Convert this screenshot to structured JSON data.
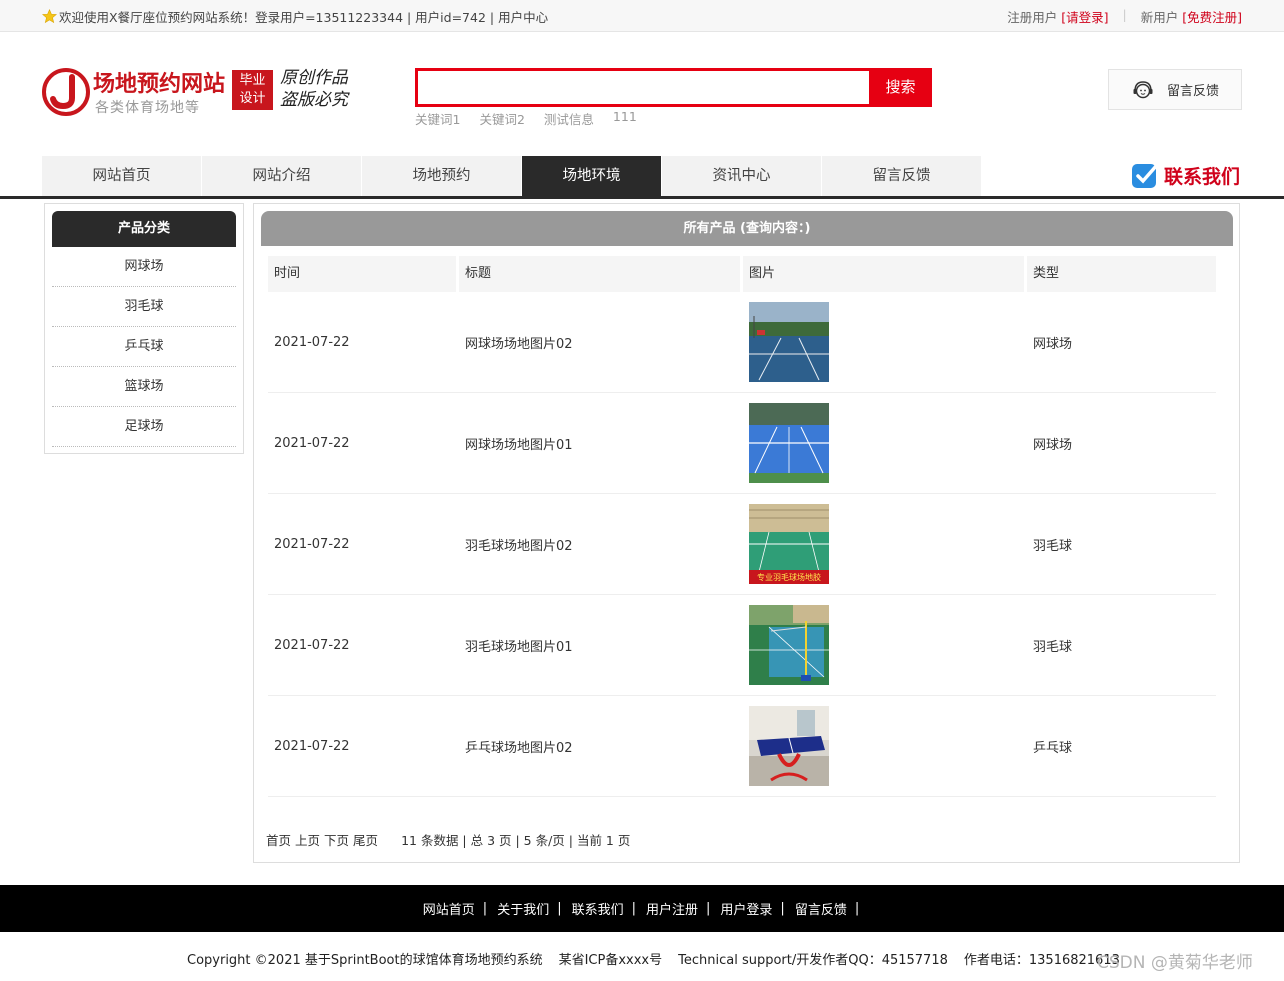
{
  "topbar": {
    "welcome": "欢迎使用X餐厅座位预约网站系统！登录用户=13511223344 | 用户id=742 | 用户中心",
    "register_user_label": "注册用户",
    "login_link": "[请登录]",
    "new_user_label": "新用户",
    "signup_link": "[免费注册]"
  },
  "header": {
    "logo_title": "场地预约网站",
    "logo_subtitle": "各类体育场地等",
    "stamp_line1": "毕业",
    "stamp_line2": "设计",
    "slogan_line1": "原创作品",
    "slogan_line2": "盗版必究",
    "search_value": "",
    "search_button": "搜索",
    "hotwords": [
      "关键词1",
      "关键词2",
      "测试信息",
      "111"
    ],
    "feedback_label": "留言反馈"
  },
  "nav": {
    "items": [
      "网站首页",
      "网站介绍",
      "场地预约",
      "场地环境",
      "资讯中心",
      "留言反馈"
    ],
    "active_index": 3,
    "contact_label": "联系我们"
  },
  "sidebar": {
    "title": "产品分类",
    "items": [
      "网球场",
      "羽毛球",
      "乒乓球",
      "篮球场",
      "足球场"
    ]
  },
  "main": {
    "title": "所有产品 (查询内容：)",
    "columns": [
      "时间",
      "标题",
      "图片",
      "类型"
    ],
    "rows": [
      {
        "time": "2021-07-22",
        "title": "网球场场地图片02",
        "type": "网球场",
        "image": "tennis-court-night"
      },
      {
        "time": "2021-07-22",
        "title": "网球场场地图片01",
        "type": "网球场",
        "image": "tennis-court-blue"
      },
      {
        "time": "2021-07-22",
        "title": "羽毛球场地图片02",
        "type": "羽毛球",
        "image": "badminton-hall",
        "image_caption": "专业羽毛球场地胶"
      },
      {
        "time": "2021-07-22",
        "title": "羽毛球场地图片01",
        "type": "羽毛球",
        "image": "badminton-outdoor"
      },
      {
        "time": "2021-07-22",
        "title": "乒乓球场地图片02",
        "type": "乒乓球",
        "image": "table-tennis"
      }
    ],
    "pager": {
      "first": "首页",
      "prev": "上页",
      "next": "下页",
      "last": "尾页",
      "info": "11 条数据 | 总 3 页 | 5 条/页 | 当前 1 页"
    }
  },
  "footer": {
    "links": [
      "网站首页",
      "关于我们",
      "联系我们",
      "用户注册",
      "用户登录",
      "留言反馈"
    ],
    "copyright": "Copyright ©2021 基于SprintBoot的球馆体育场地预约系统",
    "icp": "某省ICP备xxxx号",
    "support": "Technical support/开发作者QQ：45157718",
    "phone": "作者电话：13516821613",
    "watermark": "CSDN @黄菊华老师"
  },
  "colors": {
    "brand_red": "#e60012",
    "dark_nav": "#2a2a2a",
    "title_gray": "#999999"
  }
}
